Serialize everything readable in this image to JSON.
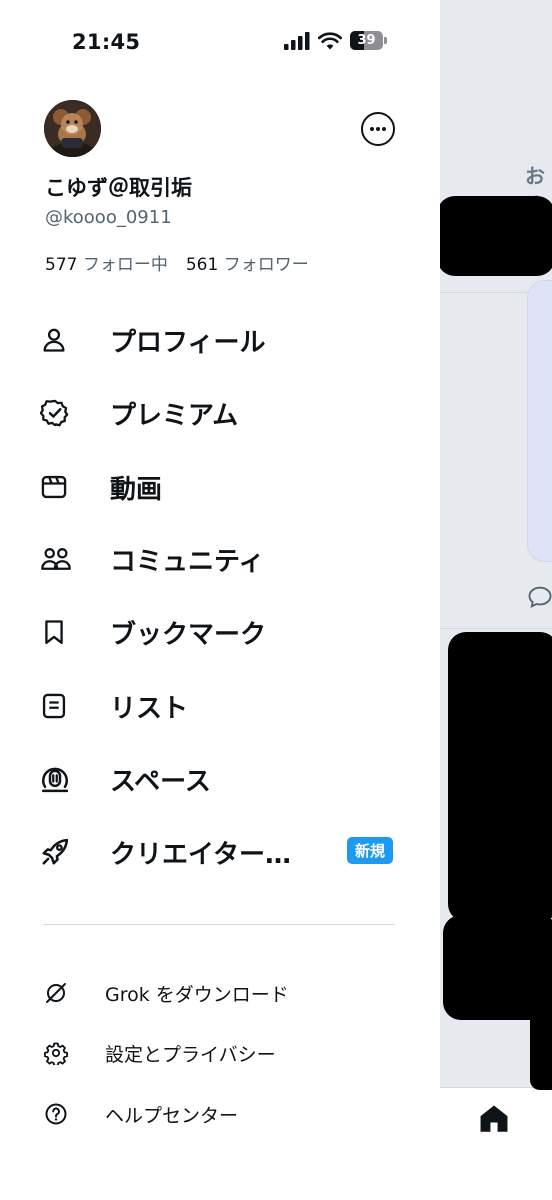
{
  "status_bar": {
    "time": "21:45",
    "battery": "39"
  },
  "profile": {
    "display_name": "こゆず＠取引垢",
    "handle": "@koooo_0911",
    "following_count": "577",
    "following_label": "フォロー中",
    "followers_count": "561",
    "followers_label": "フォロワー"
  },
  "menu": [
    {
      "label": "プロフィール",
      "icon": "person-icon"
    },
    {
      "label": "プレミアム",
      "icon": "verified-badge-icon"
    },
    {
      "label": "動画",
      "icon": "video-icon"
    },
    {
      "label": "コミュニティ",
      "icon": "communities-icon"
    },
    {
      "label": "ブックマーク",
      "icon": "bookmark-icon"
    },
    {
      "label": "リスト",
      "icon": "list-icon"
    },
    {
      "label": "スペース",
      "icon": "spaces-icon"
    },
    {
      "label": "クリエイター…",
      "icon": "rocket-icon",
      "badge": "新規"
    }
  ],
  "secondary": [
    {
      "label": "Grok をダウンロード",
      "icon": "grok-icon"
    },
    {
      "label": "設定とプライバシー",
      "icon": "gear-icon"
    },
    {
      "label": "ヘルプセンター",
      "icon": "help-icon"
    }
  ],
  "background": {
    "header_partial": "おす"
  },
  "colors": {
    "accent": "#1d9bf0",
    "text_primary": "#0f1419",
    "text_secondary": "#536471"
  }
}
